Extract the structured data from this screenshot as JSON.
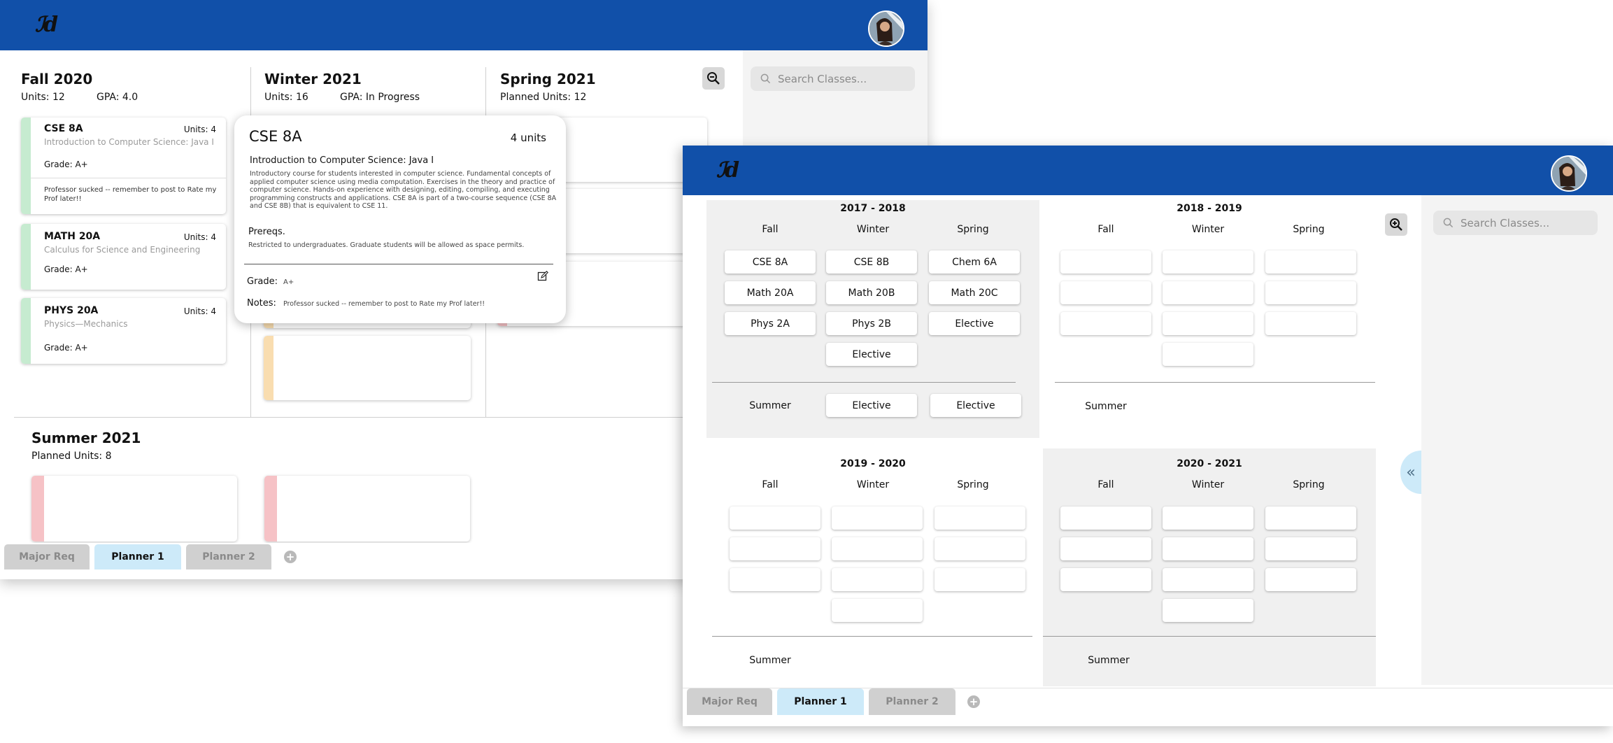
{
  "planner_semester_view": {
    "logo": "ℐd",
    "search": {
      "placeholder": "Search Classes..."
    },
    "semesters": [
      {
        "title": "Fall 2020",
        "units": "Units: 12",
        "gpa": "GPA: 4.0",
        "courses": [
          {
            "code": "CSE 8A",
            "units": "Units: 4",
            "name": "Introduction to Computer Science: Java I",
            "grade": "Grade: A+",
            "note": "Professor sucked -- remember to post to Rate my Prof later!!"
          },
          {
            "code": "MATH 20A",
            "units": "Units: 4",
            "name": "Calculus for Science and Engineering",
            "grade": "Grade: A+"
          },
          {
            "code": "PHYS 20A",
            "units": "Units: 4",
            "name": "Physics—Mechanics",
            "grade": "Grade: A+"
          }
        ]
      },
      {
        "title": "Winter 2021",
        "units": "Units: 16",
        "gpa": "GPA: In Progress"
      },
      {
        "title": "Spring 2021",
        "units": "Planned Units: 12"
      }
    ],
    "summer": {
      "title": "Summer  2021",
      "units": "Planned Units: 8"
    },
    "tabs": [
      "Major Req",
      "Planner 1",
      "Planner 2"
    ],
    "add_tab": "+"
  },
  "course_popup": {
    "code": "CSE 8A",
    "units": "4 units",
    "title": "Introduction to Computer Science: Java I",
    "description": "Introductory course for students interested in computer science. Fundamental concepts of applied computer science using media computation. Exercises in the theory and practice of computer science. Hands-on experience with designing, editing, compiling, and executing programming constructs and applications. CSE 8A is part of a two-course sequence (CSE 8A and CSE 8B) that is equivalent to CSE 11.",
    "prereq_label": "Prereqs.",
    "prereq_text": "Restricted to undergraduates. Graduate students will be allowed as space permits.",
    "grade_label": "Grade:",
    "grade_value": "A+",
    "notes_label": "Notes:",
    "notes_value": "Professor sucked -- remember to post to Rate my Prof later!!"
  },
  "planner_year_view": {
    "logo": "ℐd",
    "search": {
      "placeholder": "Search Classes..."
    },
    "quarter_labels": [
      "Fall",
      "Winter",
      "Spring"
    ],
    "summer_label": "Summer",
    "years": [
      {
        "title": "2017 - 2018",
        "fall": [
          "CSE 8A",
          "Math 20A",
          "Phys 2A"
        ],
        "winter": [
          "CSE 8B",
          "Math 20B",
          "Phys 2B",
          "Elective"
        ],
        "spring": [
          "Chem 6A",
          "Math 20C",
          "Elective"
        ],
        "summer": [
          "Elective",
          "Elective"
        ]
      },
      {
        "title": "2018 - 2019"
      },
      {
        "title": "2019 - 2020"
      },
      {
        "title": "2020 - 2021"
      }
    ],
    "tabs": [
      "Major Req",
      "Planner 1",
      "Planner 2"
    ],
    "add_tab": "+",
    "collapse_icon": "«"
  }
}
